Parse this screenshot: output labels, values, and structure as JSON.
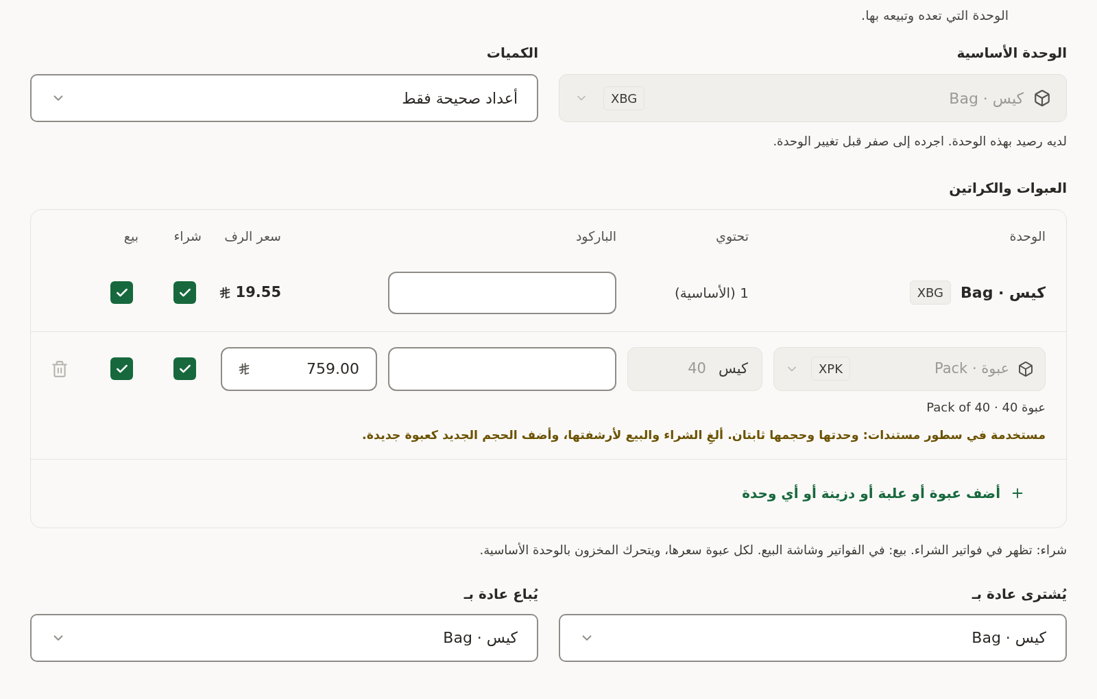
{
  "intro": "الوحدة التي تعده وتبيعه بها.",
  "base_unit": {
    "label": "الوحدة الأساسية",
    "value": "كيس · Bag",
    "code": "XBG",
    "disabled": true,
    "note": "لديه رصيد بهذه الوحدة. اجرده إلى صفر قبل تغيير الوحدة."
  },
  "quantities": {
    "label": "الكميات",
    "value": "أعداد صحيحة فقط"
  },
  "packaging": {
    "title": "العبوات والكراتين",
    "columns": [
      "الوحدة",
      "تحتوي",
      "الباركود",
      "سعر الرف",
      "شراء",
      "بيع"
    ],
    "rows": [
      {
        "kind": "base",
        "unit": "كيس · Bag",
        "code": "XBG",
        "contains": "1 (الأساسية)",
        "price": "19.55",
        "buy": true,
        "sell": true
      },
      {
        "kind": "pack",
        "unit": "عبوة · Pack",
        "code": "XPK",
        "unit_disabled": true,
        "contains_unit": "كيس",
        "contains_qty": "40",
        "contains_disabled": true,
        "price": "759.00",
        "buy": true,
        "sell": true,
        "subtitle": "عبوة 40 · Pack of 40",
        "warning": "مستخدمة في سطور مستندات: وحدتها وحجمها ثابتان. ألغِ الشراء والبيع لأرشفتها، وأضف الحجم الجديد كعبوة جديدة."
      }
    ],
    "add_button": "أضف عبوة أو علبة أو دزينة أو أي وحدة"
  },
  "footer_note": "شراء: تظهر في فواتير الشراء. بيع: في الفواتير وشاشة البيع. لكل عبوة سعرها، ويتحرك المخزون بالوحدة الأساسية.",
  "purchase_unit": {
    "label": "يُشترى عادة بـ",
    "value": "كيس · Bag"
  },
  "sales_unit": {
    "label": "يُباع عادة بـ",
    "value": "كيس · Bag"
  }
}
